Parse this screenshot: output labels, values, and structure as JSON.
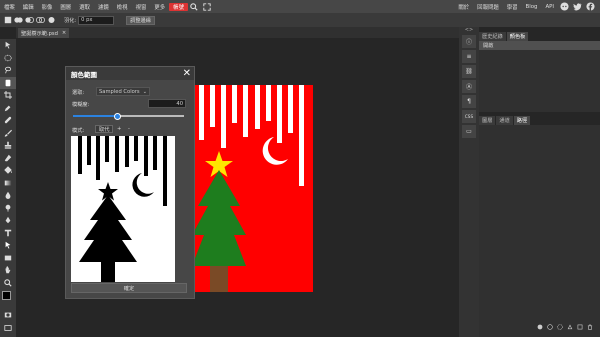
{
  "menubar": {
    "items": [
      "檔案",
      "編輯",
      "影像",
      "圖層",
      "選取",
      "濾鏡",
      "檢視",
      "視窗",
      "更多"
    ],
    "highlight": "帳號",
    "right_links": [
      "關於",
      "回報問題",
      "學習",
      "Blog",
      "API"
    ]
  },
  "optbar": {
    "feather_label": "羽化:",
    "feather_value": "0 px",
    "refine_label": "調整邊緣"
  },
  "doc_tab": {
    "name": "聖誕樹示範.psd",
    "close": "×"
  },
  "right_icons": [
    "ⓘ",
    "≡",
    "⛓",
    "Ⓐ",
    "¶",
    "CSS",
    "▭"
  ],
  "history_panel": {
    "tabs": [
      "歷史紀錄",
      "顏色板"
    ],
    "rows": [
      "開啟"
    ]
  },
  "layers_panel": {
    "tabs": [
      "圖層",
      "通道",
      "路徑"
    ],
    "active_index": 2
  },
  "dialog": {
    "title": "顏色範圍",
    "select_label": "選取:",
    "select_value": "Sampled Colors",
    "fuzziness_label": "模糊度:",
    "fuzziness_value": "40",
    "fuzziness_fraction": 0.4,
    "mode_label": "模式:",
    "mode_value": "取代",
    "mode_add": "+",
    "mode_sub": "-",
    "ok_label": "確定"
  },
  "colors": {
    "accent": "#d33333",
    "art_red": "#ff0000",
    "tree_green": "#1e7d1e",
    "star_yellow": "#ffe400",
    "trunk_brown": "#7a4a26"
  }
}
